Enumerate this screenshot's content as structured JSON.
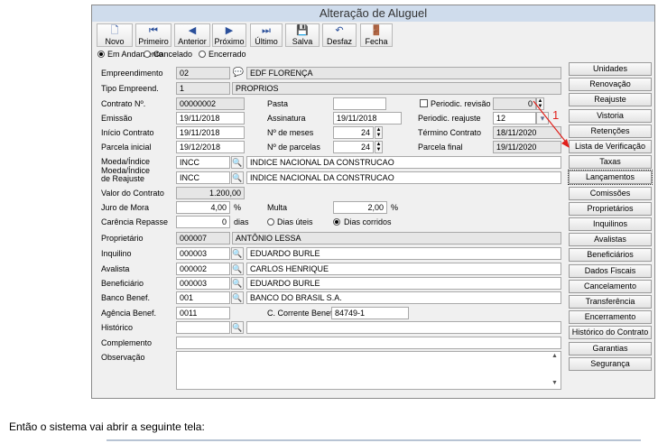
{
  "window": {
    "title": "Alteração de Aluguel"
  },
  "toolbar": [
    {
      "label": "Novo",
      "icon": "new-document-icon",
      "glyph": "🗋"
    },
    {
      "label": "Primeiro",
      "icon": "first-icon",
      "glyph": "⏮"
    },
    {
      "label": "Anterior",
      "icon": "previous-icon",
      "glyph": "◀"
    },
    {
      "label": "Próximo",
      "icon": "next-icon",
      "glyph": "▶"
    },
    {
      "label": "Último",
      "icon": "last-icon",
      "glyph": "⏭"
    },
    {
      "label": "Salva",
      "icon": "save-icon",
      "glyph": "💾"
    },
    {
      "label": "Desfaz",
      "icon": "undo-icon",
      "glyph": "↶"
    },
    {
      "label": "Fecha",
      "icon": "close-door-icon",
      "glyph": "🚪"
    }
  ],
  "status_radios": [
    {
      "label": "Em Andamento",
      "selected": true
    },
    {
      "label": "Cancelado",
      "selected": false
    },
    {
      "label": "Encerrado",
      "selected": false
    }
  ],
  "form": {
    "empreendimento": {
      "label": "Empreendimento",
      "code": "02",
      "name": "EDF FLORENÇA"
    },
    "tipo_empreend": {
      "label": "Tipo Empreend.",
      "code": "1",
      "name": "PROPRIOS"
    },
    "contrato": {
      "label": "Contrato Nº.",
      "value": "00000002"
    },
    "pasta": {
      "label": "Pasta",
      "value": ""
    },
    "periodic_revisao": {
      "label": "Periodic. revisão",
      "value": "0"
    },
    "emissao": {
      "label": "Emissão",
      "value": "19/11/2018"
    },
    "assinatura": {
      "label": "Assinatura",
      "value": "19/11/2018"
    },
    "periodic_reajuste": {
      "label": "Periodic. reajuste",
      "value": "12"
    },
    "inicio_contrato": {
      "label": "Início Contrato",
      "value": "19/11/2018"
    },
    "num_meses": {
      "label": "Nº de meses",
      "value": "24"
    },
    "termino_contrato": {
      "label": "Término Contrato",
      "value": "18/11/2020"
    },
    "parcela_inicial": {
      "label": "Parcela inicial",
      "value": "19/12/2018"
    },
    "num_parcelas": {
      "label": "Nº de parcelas",
      "value": "24"
    },
    "parcela_final": {
      "label": "Parcela final",
      "value": "19/11/2020"
    },
    "moeda_indice": {
      "label": "Moeda/Índice",
      "code": "INCC",
      "name": "INDICE NACIONAL DA CONSTRUCAO"
    },
    "moeda_reajuste": {
      "label1": "Moeda/Índice",
      "label2": "de Reajuste",
      "code": "INCC",
      "name": "INDICE NACIONAL DA CONSTRUCAO"
    },
    "valor_contrato": {
      "label": "Valor do Contrato",
      "value": "1.200,00"
    },
    "juro_mora": {
      "label": "Juro de Mora",
      "value": "4,00",
      "unit": "%"
    },
    "multa": {
      "label": "Multa",
      "value": "2,00",
      "unit": "%"
    },
    "carencia": {
      "label": "Carência Repasse",
      "value": "0",
      "unit": "dias"
    },
    "dias_uteis": {
      "label": "Dias úteis",
      "selected": false
    },
    "dias_corridos": {
      "label": "Dias corridos",
      "selected": true
    },
    "proprietario": {
      "label": "Proprietário",
      "code": "000007",
      "name": "ANTÔNIO LESSA"
    },
    "inquilino": {
      "label": "Inquilino",
      "code": "000003",
      "name": "EDUARDO BURLE"
    },
    "avalista": {
      "label": "Avalista",
      "code": "000002",
      "name": "CARLOS HENRIQUE"
    },
    "beneficiario": {
      "label": "Beneficiário",
      "code": "000003",
      "name": "EDUARDO BURLE"
    },
    "banco_benef": {
      "label": "Banco Benef.",
      "code": "001",
      "name": "BANCO DO BRASIL S.A."
    },
    "agencia_benef": {
      "label": "Agência Benef.",
      "value": "0011"
    },
    "conta_corrente": {
      "label": "C. Corrente Benef.",
      "value": "84749-1"
    },
    "historico": {
      "label": "Histórico",
      "code": "",
      "name": ""
    },
    "complemento": {
      "label": "Complemento",
      "value": ""
    },
    "observacao": {
      "label": "Observação",
      "value": ""
    }
  },
  "right_buttons": [
    "Unidades",
    "Renovação",
    "Reajuste",
    "Vistoria",
    "Retenções",
    "Lista de Verificação",
    "Taxas",
    "Lançamentos",
    "Comissões",
    "Proprietários",
    "Inquilinos",
    "Avalistas",
    "Beneficiários",
    "Dados Fiscais",
    "Cancelamento",
    "Transferência",
    "Encerramento",
    "Histórico do Contrato",
    "Garantias",
    "Segurança"
  ],
  "annotation": {
    "number": "1",
    "color": "#e0201b"
  },
  "caption": "Então o sistema vai abrir a seguinte tela:"
}
